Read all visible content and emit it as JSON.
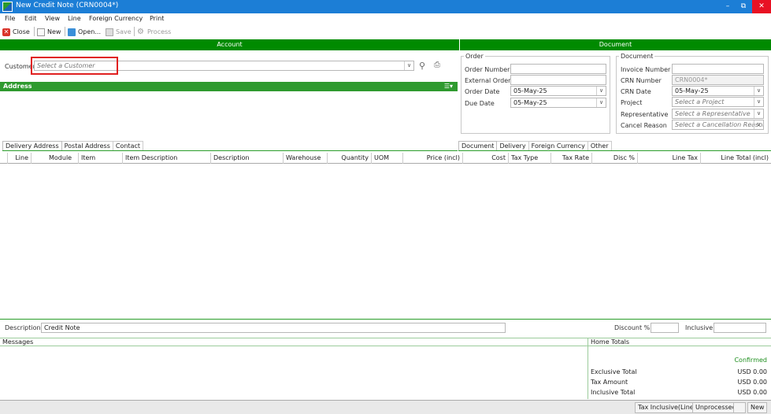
{
  "window": {
    "title": "New Credit Note (CRN0004*)"
  },
  "menu": [
    "File",
    "Edit",
    "View",
    "Line",
    "Foreign Currency",
    "Print"
  ],
  "toolbar": {
    "close": "Close",
    "new": "New",
    "open": "Open...",
    "save": "Save",
    "process": "Process"
  },
  "sections": {
    "account": "Account",
    "document": "Document"
  },
  "customer": {
    "label": "Customer",
    "placeholder": "Select a Customer"
  },
  "address": {
    "title": "Address"
  },
  "order": {
    "legend": "Order",
    "order_number_label": "Order Number",
    "order_number": "",
    "external_order_label": "External Order",
    "external_order": "",
    "order_date_label": "Order Date",
    "order_date": "05-May-25",
    "due_date_label": "Due Date",
    "due_date": "05-May-25"
  },
  "document": {
    "legend": "Document",
    "invoice_number_label": "Invoice Number",
    "invoice_number": "",
    "crn_number_label": "CRN Number",
    "crn_number": "CRN0004*",
    "crn_date_label": "CRN Date",
    "crn_date": "05-May-25",
    "project_label": "Project",
    "project_placeholder": "Select a Project",
    "rep_label": "Representative",
    "rep_placeholder": "Select a Representative",
    "cancel_label": "Cancel Reason",
    "cancel_placeholder": "Select a Cancellation Reason"
  },
  "left_tabs": [
    "Delivery Address",
    "Postal Address",
    "Contact"
  ],
  "right_tabs": [
    "Document",
    "Delivery",
    "Foreign Currency",
    "Other"
  ],
  "grid": {
    "columns": [
      "Line",
      "Module",
      "Item",
      "Item Description",
      "Description",
      "Warehouse",
      "Quantity",
      "UOM",
      "Price (incl)",
      "Cost",
      "Tax Type",
      "Tax Rate",
      "Disc %",
      "Line Tax",
      "Line Total (incl)"
    ]
  },
  "footer": {
    "description_label": "Description",
    "description": "Credit Note",
    "discount_label": "Discount %",
    "discount": "",
    "inclusive_label": "Inclusive",
    "inclusive": ""
  },
  "messages": {
    "title": "Messages"
  },
  "home_totals": {
    "title": "Home Totals",
    "status": "Confirmed",
    "exclusive_label": "Exclusive Total",
    "exclusive": "USD 0.00",
    "tax_label": "Tax Amount",
    "tax": "USD 0.00",
    "inclusive_label": "Inclusive Total",
    "inclusive": "USD 0.00"
  },
  "statusbar": {
    "tax_mode": "Tax Inclusive(Line)",
    "state": "Unprocessed",
    "empty": "",
    "mode": "New"
  },
  "colors": {
    "title_bar": "#1c7ed6",
    "section_bar": "#008a00",
    "highlight": "#e02020"
  }
}
